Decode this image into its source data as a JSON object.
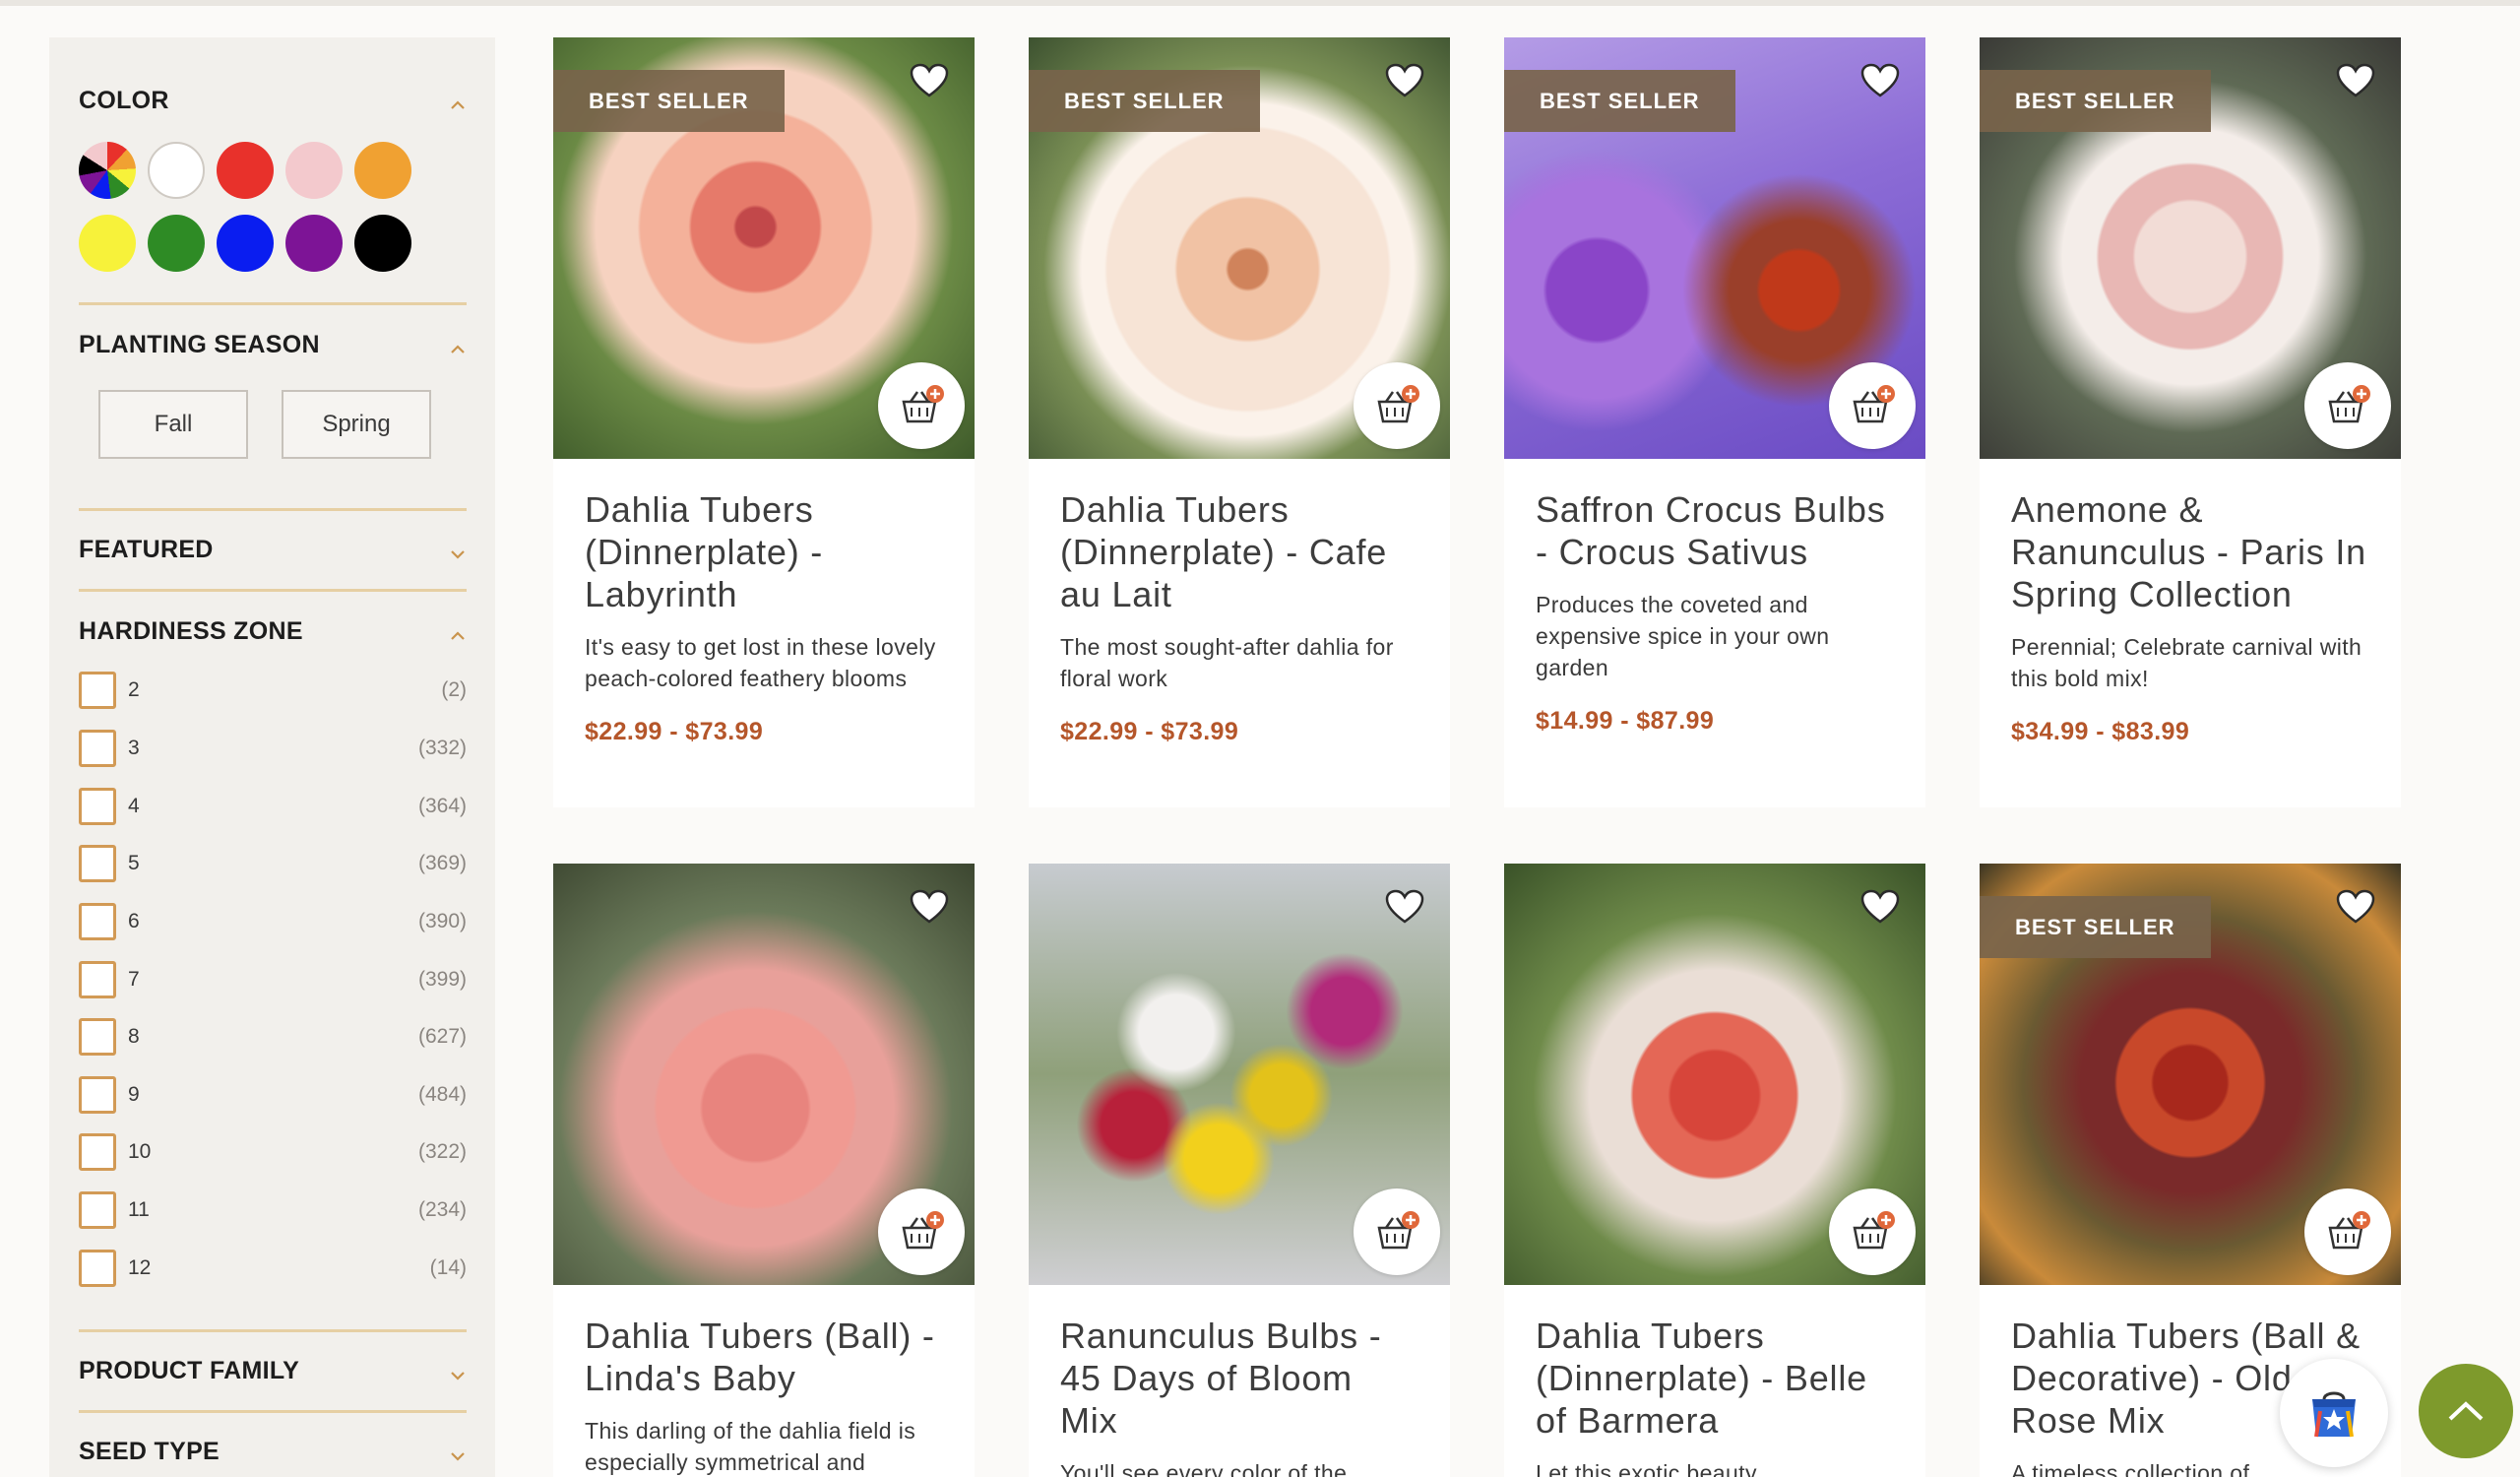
{
  "filters": {
    "color": {
      "title": "COLOR",
      "swatches": [
        {
          "name": "multicolor",
          "color": "multi"
        },
        {
          "name": "white",
          "color": "#ffffff"
        },
        {
          "name": "red",
          "color": "#e8312b"
        },
        {
          "name": "pink",
          "color": "#f3c9cd"
        },
        {
          "name": "orange",
          "color": "#f0a132"
        },
        {
          "name": "yellow",
          "color": "#f7f23a"
        },
        {
          "name": "green",
          "color": "#2e8b25"
        },
        {
          "name": "blue",
          "color": "#0a1df0"
        },
        {
          "name": "purple",
          "color": "#7d1496"
        },
        {
          "name": "black",
          "color": "#000000"
        }
      ]
    },
    "planting_season": {
      "title": "PLANTING SEASON",
      "options": [
        "Fall",
        "Spring"
      ]
    },
    "featured": {
      "title": "FEATURED"
    },
    "hardiness_zone": {
      "title": "HARDINESS ZONE",
      "zones": [
        {
          "label": "2",
          "count": "(2)"
        },
        {
          "label": "3",
          "count": "(332)"
        },
        {
          "label": "4",
          "count": "(364)"
        },
        {
          "label": "5",
          "count": "(369)"
        },
        {
          "label": "6",
          "count": "(390)"
        },
        {
          "label": "7",
          "count": "(399)"
        },
        {
          "label": "8",
          "count": "(627)"
        },
        {
          "label": "9",
          "count": "(484)"
        },
        {
          "label": "10",
          "count": "(322)"
        },
        {
          "label": "11",
          "count": "(234)"
        },
        {
          "label": "12",
          "count": "(14)"
        }
      ]
    },
    "product_family": {
      "title": "PRODUCT FAMILY"
    },
    "seed_type": {
      "title": "SEED TYPE"
    }
  },
  "products": [
    {
      "badge": "BEST SELLER",
      "title": "Dahlia Tubers (Dinnerplate) - Labyrinth",
      "description": "It's easy to get lost in these lovely peach-colored feathery blooms",
      "price": "$22.99 - $73.99"
    },
    {
      "badge": "BEST SELLER",
      "title": "Dahlia Tubers (Dinnerplate) - Cafe au Lait",
      "description": "The most sought-after dahlia for floral work",
      "price": "$22.99 - $73.99"
    },
    {
      "badge": "BEST SELLER",
      "title": "Saffron Crocus Bulbs - Crocus Sativus",
      "description": "Produces the coveted and expensive spice in your own garden",
      "price": "$14.99 - $87.99"
    },
    {
      "badge": "BEST SELLER",
      "title": "Anemone & Ranunculus - Paris In Spring Collection",
      "description": "Perennial; Celebrate carnival with this bold mix!",
      "price": "$34.99 - $83.99"
    },
    {
      "badge": "",
      "title": "Dahlia Tubers (Ball) - Linda's Baby",
      "description": "This darling of the dahlia field is especially symmetrical and",
      "price": ""
    },
    {
      "badge": "",
      "title": "Ranunculus Bulbs - 45 Days of Bloom Mix",
      "description": "You'll see every color of the",
      "price": ""
    },
    {
      "badge": "",
      "title": "Dahlia Tubers (Dinnerplate) - Belle of Barmera",
      "description": "Let this exotic beauty",
      "price": ""
    },
    {
      "badge": "BEST SELLER",
      "title": "Dahlia Tubers (Ball & Decorative) - Old Rose Mix",
      "description": "A timeless collection of",
      "price": ""
    }
  ],
  "colors": {
    "accent_price": "#b5562a",
    "checkbox_border": "#d29a55",
    "scroll_top_button": "#7e9a2c"
  }
}
